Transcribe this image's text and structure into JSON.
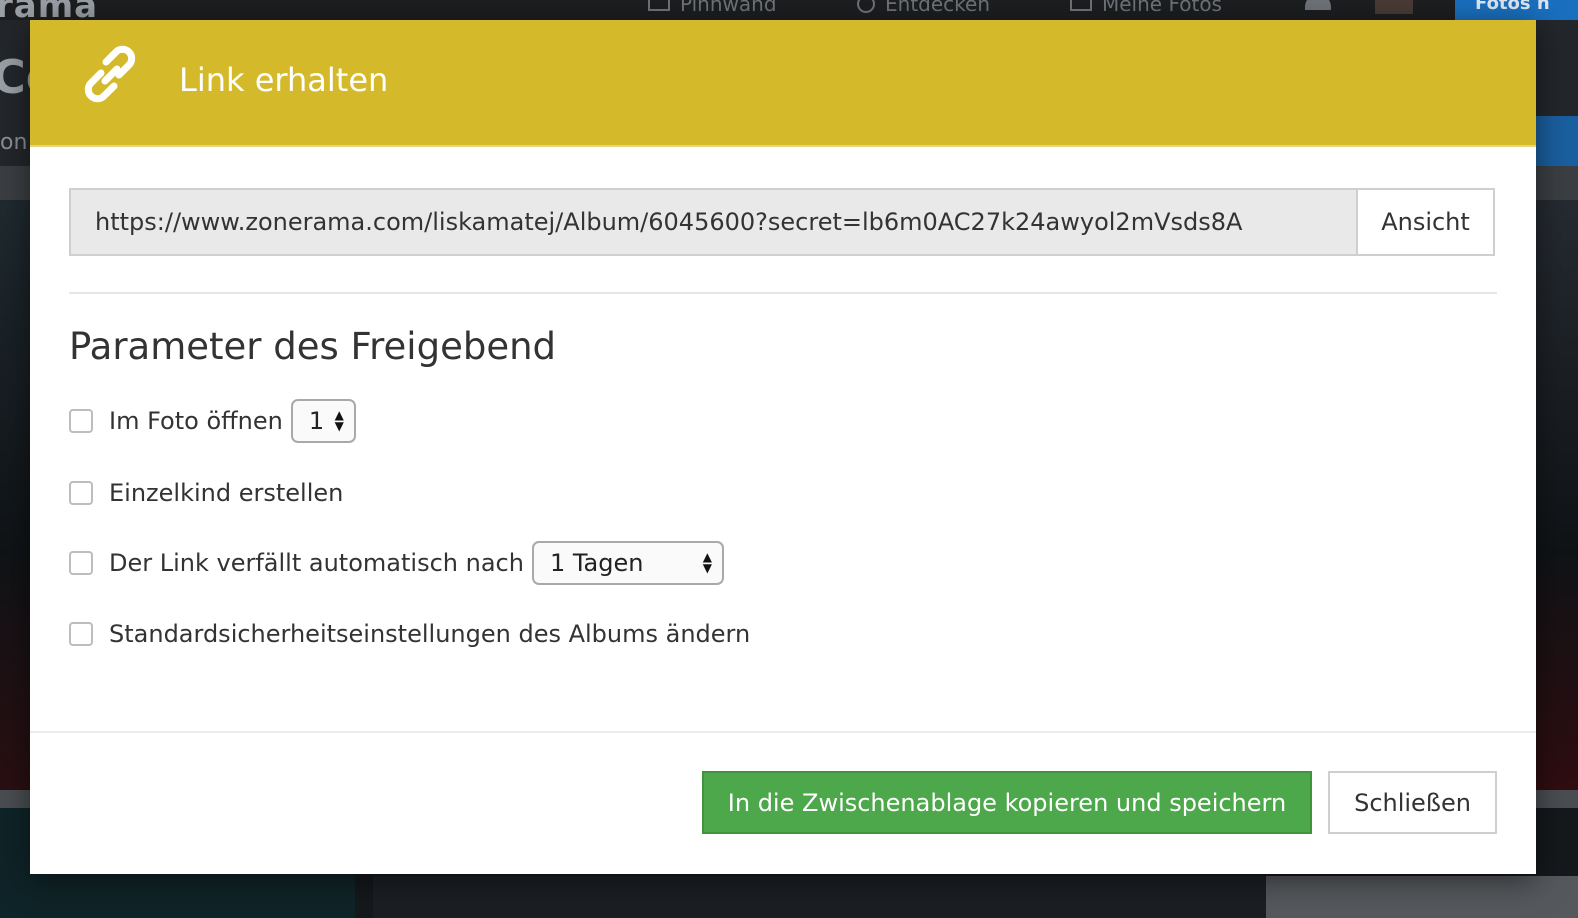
{
  "background": {
    "logo": "rama",
    "nav": [
      {
        "label": "Pinnwand",
        "icon": "wall-icon"
      },
      {
        "label": "Entdecken",
        "icon": "globe-icon"
      },
      {
        "label": "Meine Fotos",
        "icon": "photos-icon"
      }
    ],
    "cta_label": "Fotos h",
    "header_title": "Co",
    "header_sub": "on"
  },
  "modal": {
    "title": "Link erhalten",
    "icon": "link-icon",
    "url": "https://www.zonerama.com/liskamatej/Album/6045600?secret=lb6m0AC27k24awyol2mVsds8A",
    "view_label": "Ansicht",
    "section_title": "Parameter des Freigebend",
    "options": [
      {
        "label": "Im Foto öffnen",
        "checked": false,
        "select_value": "1"
      },
      {
        "label": "Einzelkind erstellen",
        "checked": false
      },
      {
        "label": "Der Link verfällt automatisch nach",
        "checked": false,
        "select_value": "1 Tagen"
      },
      {
        "label": "Standardsicherheitseinstellungen des Albums ändern",
        "checked": false
      }
    ],
    "copy_label": "In die Zwischenablage kopieren und speichern",
    "close_label": "Schließen"
  },
  "colors": {
    "header": "#d4ba2a",
    "primary_button": "#4ca84a"
  }
}
